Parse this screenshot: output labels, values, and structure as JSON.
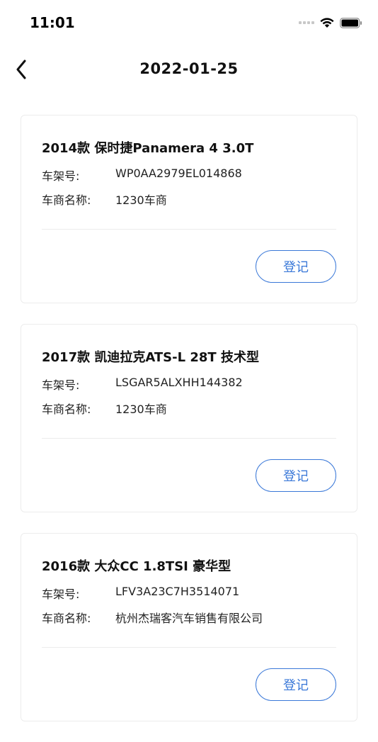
{
  "status_bar": {
    "time": "11:01"
  },
  "nav": {
    "title": "2022-01-25"
  },
  "colors": {
    "accent": "#3a78d8",
    "card_border": "#ececec"
  },
  "cards": [
    {
      "title": "2014款 保时捷Panamera 4 3.0T",
      "vin_label": "车架号:",
      "vin": "WP0AA2979EL014868",
      "dealer_label": "车商名称:",
      "dealer": "1230车商",
      "button_label": "登记"
    },
    {
      "title": "2017款 凯迪拉克ATS-L 28T 技术型",
      "vin_label": "车架号:",
      "vin": "LSGAR5ALXHH144382",
      "dealer_label": "车商名称:",
      "dealer": "1230车商",
      "button_label": "登记"
    },
    {
      "title": "2016款 大众CC 1.8TSI 豪华型",
      "vin_label": "车架号:",
      "vin": "LFV3A23C7H3514071",
      "dealer_label": "车商名称:",
      "dealer": "杭州杰瑞客汽车销售有限公司",
      "button_label": "登记"
    }
  ]
}
